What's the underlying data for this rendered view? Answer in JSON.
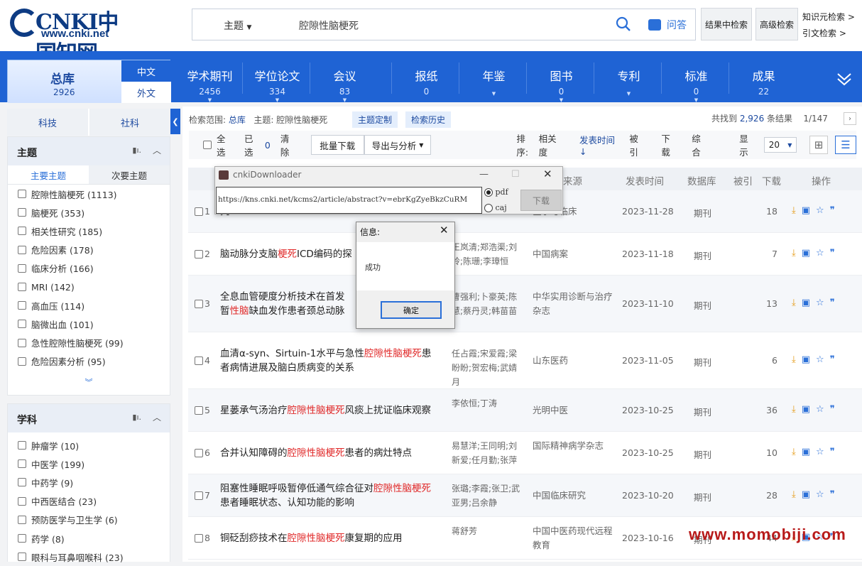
{
  "header": {
    "logo_text": "CNKI中国知网",
    "logo_url": "www.cnki.net",
    "search_scope": "主题",
    "search_query": "腔隙性脑梗死",
    "ask_label": "问答",
    "btn_in_result": "结果中检索",
    "btn_advanced": "高级检索",
    "link_knowledge": "知识元检索 >",
    "link_citation": "引文检索 >"
  },
  "nav": {
    "total_label": "总库",
    "total_count": "2926",
    "lang_zh": "中文",
    "lang_foreign": "外文",
    "items": [
      {
        "label": "学术期刊",
        "count": "2456"
      },
      {
        "label": "学位论文",
        "count": "334"
      },
      {
        "label": "会议",
        "count": "83"
      },
      {
        "label": "报纸",
        "count": "0"
      },
      {
        "label": "年鉴",
        "count": ""
      },
      {
        "label": "图书",
        "count": "0"
      },
      {
        "label": "专利",
        "count": ""
      },
      {
        "label": "标准",
        "count": "0"
      },
      {
        "label": "成果",
        "count": "22"
      }
    ]
  },
  "sidebar": {
    "subject": {
      "title": "主题",
      "tab_main": "主要主题",
      "tab_sub": "次要主题",
      "items": [
        "腔隙性脑梗死 (1113)",
        "脑梗死 (353)",
        "相关性研究 (185)",
        "危险因素 (178)",
        "临床分析 (166)",
        "MRI (142)",
        "高血压 (114)",
        "脑微出血 (101)",
        "急性腔隙性脑梗死 (99)",
        "危险因素分析 (95)"
      ]
    },
    "tabs": {
      "science": "科技",
      "social": "社科"
    },
    "discipline": {
      "title": "学科",
      "items": [
        "肿瘤学 (10)",
        "中医学 (199)",
        "中药学 (9)",
        "中西医结合 (23)",
        "预防医学与卫生学 (6)",
        "药学 (8)",
        "眼科与耳鼻咽喉科 (23)"
      ]
    }
  },
  "results": {
    "scope_label": "检索范围:",
    "scope_value": "总库",
    "theme_label": "主题:",
    "theme_value": "腔隙性脑梗死",
    "btn_theme": "主题定制",
    "btn_history": "检索历史",
    "found_prefix": "共找到",
    "found_count": "2,926",
    "found_suffix": "条结果",
    "page": "1/147",
    "select_all": "全选",
    "selected_label": "已选",
    "selected_count": "0",
    "clear": "清除",
    "batch_download": "批量下载",
    "export": "导出与分析",
    "sort_label": "排序:",
    "sort_relevance": "相关度",
    "sort_date": "发表时间",
    "sort_cited": "被引",
    "sort_download": "下载",
    "sort_overall": "综合",
    "display_label": "显示",
    "display_count": "20",
    "columns": {
      "source": "来源",
      "date": "发表时间",
      "db": "数据库",
      "cited": "被引",
      "downloads": "下载",
      "ops": "操作"
    },
    "rows": [
      {
        "num": "1",
        "title_parts": [
          "究"
        ],
        "authors": "",
        "source": "医学与临床",
        "date": "2023-11-28",
        "db": "期刊",
        "cited": "",
        "downloads": "18"
      },
      {
        "num": "2",
        "title_parts": [
          "脑动脉分支脑",
          "梗死",
          "ICD编码的探"
        ],
        "authors": "王岚清;郑浩渠;刘玲;陈珊;李璋恒",
        "source": "中国病案",
        "date": "2023-11-18",
        "db": "期刊",
        "cited": "",
        "downloads": "7"
      },
      {
        "num": "3",
        "title_parts": [
          "全息血管硬度分析技术在首发",
          "",
          "",
          "暂",
          "性脑",
          "缺血发作患者颈总动脉"
        ],
        "authors": "曹强利;卜豪英;陈慧;蔡丹灵;韩苗苗",
        "source": "中华实用诊断与治疗杂志",
        "date": "2023-11-10",
        "db": "期刊",
        "cited": "",
        "downloads": "13"
      },
      {
        "num": "4",
        "title_parts": [
          "血清α-syn、Sirtuin-1水平与急性",
          "腔隙性脑梗死",
          "患者病情进展及脑白质病变的关系"
        ],
        "authors": "任占霞;宋爱霞;梁盼盼;贺宏梅;武婧月",
        "source": "山东医药",
        "date": "2023-11-05",
        "db": "期刊",
        "cited": "",
        "downloads": "6"
      },
      {
        "num": "5",
        "title_parts": [
          "星蒌承气汤治疗",
          "腔隙性脑梗死",
          "风痰上扰证临床观察"
        ],
        "authors": "李依恒;丁涛",
        "source": "光明中医",
        "date": "2023-10-25",
        "db": "期刊",
        "cited": "",
        "downloads": "36"
      },
      {
        "num": "6",
        "title_parts": [
          "合并认知障碍的",
          "腔隙性脑梗死",
          "患者的病灶特点"
        ],
        "authors": "易慧洋;王同明;刘新爱;任月勤;张萍",
        "source": "国际精神病学杂志",
        "date": "2023-10-25",
        "db": "期刊",
        "cited": "",
        "downloads": "10"
      },
      {
        "num": "7",
        "title_parts": [
          "阻塞性睡眠呼吸暂停低通气综合征对",
          "腔隙性脑梗",
          "死",
          "患者睡眠状态、认知功能的影响"
        ],
        "authors": "张璐;李霞;张卫;武亚男;吕余静",
        "source": "中国临床研究",
        "date": "2023-10-20",
        "db": "期刊",
        "cited": "",
        "downloads": "28"
      },
      {
        "num": "8",
        "title_parts": [
          "铜砭刮痧技术在",
          "腔隙性脑梗死",
          "康复期的应用"
        ],
        "authors": "蒋舒芳",
        "source": "中国中医药现代远程教育",
        "date": "2023-10-16",
        "db": "期刊",
        "cited": "",
        "downloads": "44"
      }
    ]
  },
  "downloader": {
    "title": "cnkiDownloader",
    "url": "https://kns.cnki.net/kcms2/article/abstract?v=ebrKgZyeBkzCuRM",
    "opt_pdf": "pdf",
    "opt_caj": "caj",
    "download": "下载"
  },
  "message": {
    "title": "信息:",
    "text": "成功",
    "ok": "确定"
  },
  "watermark": "www.momobiji.com"
}
